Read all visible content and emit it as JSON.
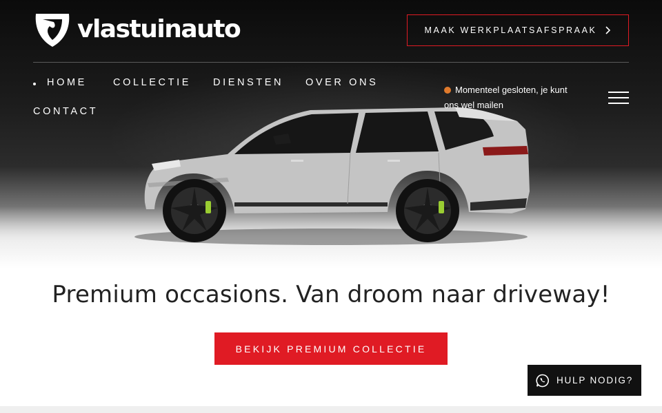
{
  "brand": {
    "name": "vlastuinauto",
    "icon": "shield-logo-icon"
  },
  "header": {
    "cta_label": "MAAK WERKPLAATSAFSPRAAK",
    "cta_icon": "chevron-right-icon",
    "accent": "#e01b24"
  },
  "nav": {
    "items": [
      {
        "label": "HOME"
      },
      {
        "label": "COLLECTIE"
      },
      {
        "label": "DIENSTEN"
      },
      {
        "label": "OVER ONS"
      },
      {
        "label": "CONTACT"
      }
    ]
  },
  "status": {
    "text": "Momenteel gesloten, je kunt ons wel mailen",
    "color": "#e07a2c"
  },
  "menu": {
    "icon": "hamburger-menu-icon"
  },
  "hero": {
    "image": "grey-suv-car-image",
    "headline": "Premium occasions. Van droom naar driveway!",
    "cta_label": "BEKIJK PREMIUM COLLECTIE"
  },
  "help": {
    "label": "HULP NODIG?",
    "icon": "whatsapp-icon",
    "background": "#111111"
  }
}
